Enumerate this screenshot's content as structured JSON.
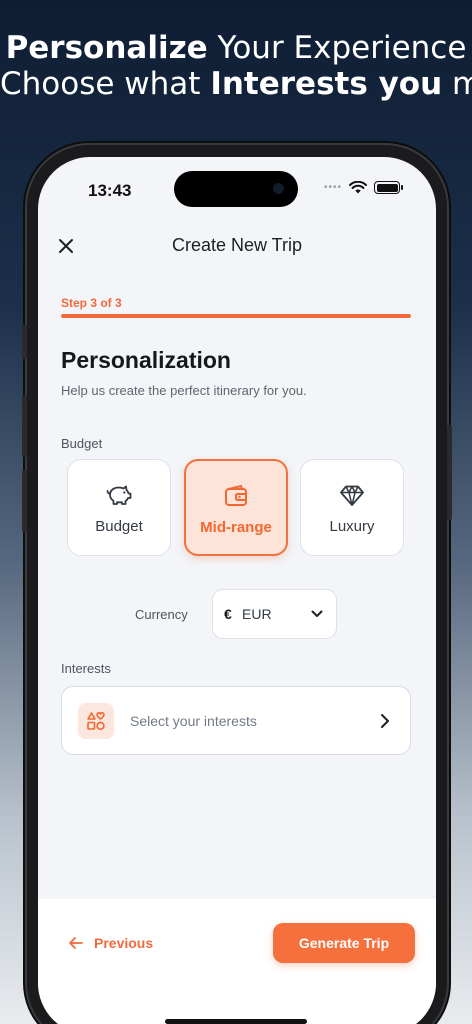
{
  "promo": {
    "line1_bold": "Personalize",
    "line1_rest": " Your Experience",
    "line2_start": "Choose what ",
    "line2_bold": "Interests you",
    "line2_end": " most"
  },
  "status_bar": {
    "time": "13:43",
    "dots": "••••"
  },
  "nav": {
    "title": "Create New Trip",
    "close_icon": "close-icon"
  },
  "progress": {
    "step_label": "Step 3 of 3",
    "fraction": 1.0,
    "color": "#f26a3c"
  },
  "section": {
    "title": "Personalization",
    "subtitle": "Help us create the perfect itinerary for you."
  },
  "budget": {
    "label": "Budget",
    "options": [
      {
        "label": "Budget",
        "icon": "piggy-bank-icon",
        "selected": false
      },
      {
        "label": "Mid-range",
        "icon": "wallet-icon",
        "selected": true
      },
      {
        "label": "Luxury",
        "icon": "diamond-icon",
        "selected": false
      }
    ]
  },
  "currency": {
    "label": "Currency",
    "symbol": "€",
    "value": "EUR"
  },
  "interests": {
    "label": "Interests",
    "placeholder": "Select your interests",
    "icon": "shapes-icon"
  },
  "footer": {
    "previous_label": "Previous",
    "generate_label": "Generate Trip"
  },
  "colors": {
    "accent": "#f26a3c",
    "accent_light": "#fde3d8",
    "background": "#f3f5f8"
  }
}
